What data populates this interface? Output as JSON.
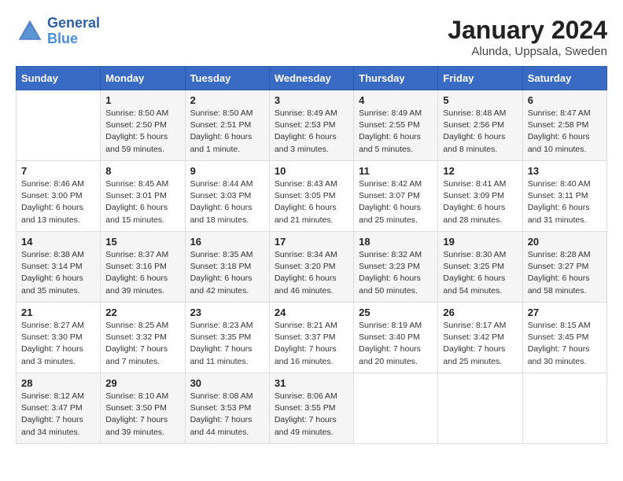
{
  "header": {
    "logo_general": "General",
    "logo_blue": "Blue",
    "month_year": "January 2024",
    "location": "Alunda, Uppsala, Sweden"
  },
  "days_of_week": [
    "Sunday",
    "Monday",
    "Tuesday",
    "Wednesday",
    "Thursday",
    "Friday",
    "Saturday"
  ],
  "weeks": [
    [
      {
        "day": "",
        "info": ""
      },
      {
        "day": "1",
        "info": "Sunrise: 8:50 AM\nSunset: 2:50 PM\nDaylight: 5 hours\nand 59 minutes."
      },
      {
        "day": "2",
        "info": "Sunrise: 8:50 AM\nSunset: 2:51 PM\nDaylight: 6 hours\nand 1 minute."
      },
      {
        "day": "3",
        "info": "Sunrise: 8:49 AM\nSunset: 2:53 PM\nDaylight: 6 hours\nand 3 minutes."
      },
      {
        "day": "4",
        "info": "Sunrise: 8:49 AM\nSunset: 2:55 PM\nDaylight: 6 hours\nand 5 minutes."
      },
      {
        "day": "5",
        "info": "Sunrise: 8:48 AM\nSunset: 2:56 PM\nDaylight: 6 hours\nand 8 minutes."
      },
      {
        "day": "6",
        "info": "Sunrise: 8:47 AM\nSunset: 2:58 PM\nDaylight: 6 hours\nand 10 minutes."
      }
    ],
    [
      {
        "day": "7",
        "info": "Sunrise: 8:46 AM\nSunset: 3:00 PM\nDaylight: 6 hours\nand 13 minutes."
      },
      {
        "day": "8",
        "info": "Sunrise: 8:45 AM\nSunset: 3:01 PM\nDaylight: 6 hours\nand 15 minutes."
      },
      {
        "day": "9",
        "info": "Sunrise: 8:44 AM\nSunset: 3:03 PM\nDaylight: 6 hours\nand 18 minutes."
      },
      {
        "day": "10",
        "info": "Sunrise: 8:43 AM\nSunset: 3:05 PM\nDaylight: 6 hours\nand 21 minutes."
      },
      {
        "day": "11",
        "info": "Sunrise: 8:42 AM\nSunset: 3:07 PM\nDaylight: 6 hours\nand 25 minutes."
      },
      {
        "day": "12",
        "info": "Sunrise: 8:41 AM\nSunset: 3:09 PM\nDaylight: 6 hours\nand 28 minutes."
      },
      {
        "day": "13",
        "info": "Sunrise: 8:40 AM\nSunset: 3:11 PM\nDaylight: 6 hours\nand 31 minutes."
      }
    ],
    [
      {
        "day": "14",
        "info": "Sunrise: 8:38 AM\nSunset: 3:14 PM\nDaylight: 6 hours\nand 35 minutes."
      },
      {
        "day": "15",
        "info": "Sunrise: 8:37 AM\nSunset: 3:16 PM\nDaylight: 6 hours\nand 39 minutes."
      },
      {
        "day": "16",
        "info": "Sunrise: 8:35 AM\nSunset: 3:18 PM\nDaylight: 6 hours\nand 42 minutes."
      },
      {
        "day": "17",
        "info": "Sunrise: 8:34 AM\nSunset: 3:20 PM\nDaylight: 6 hours\nand 46 minutes."
      },
      {
        "day": "18",
        "info": "Sunrise: 8:32 AM\nSunset: 3:23 PM\nDaylight: 6 hours\nand 50 minutes."
      },
      {
        "day": "19",
        "info": "Sunrise: 8:30 AM\nSunset: 3:25 PM\nDaylight: 6 hours\nand 54 minutes."
      },
      {
        "day": "20",
        "info": "Sunrise: 8:28 AM\nSunset: 3:27 PM\nDaylight: 6 hours\nand 58 minutes."
      }
    ],
    [
      {
        "day": "21",
        "info": "Sunrise: 8:27 AM\nSunset: 3:30 PM\nDaylight: 7 hours\nand 3 minutes."
      },
      {
        "day": "22",
        "info": "Sunrise: 8:25 AM\nSunset: 3:32 PM\nDaylight: 7 hours\nand 7 minutes."
      },
      {
        "day": "23",
        "info": "Sunrise: 8:23 AM\nSunset: 3:35 PM\nDaylight: 7 hours\nand 11 minutes."
      },
      {
        "day": "24",
        "info": "Sunrise: 8:21 AM\nSunset: 3:37 PM\nDaylight: 7 hours\nand 16 minutes."
      },
      {
        "day": "25",
        "info": "Sunrise: 8:19 AM\nSunset: 3:40 PM\nDaylight: 7 hours\nand 20 minutes."
      },
      {
        "day": "26",
        "info": "Sunrise: 8:17 AM\nSunset: 3:42 PM\nDaylight: 7 hours\nand 25 minutes."
      },
      {
        "day": "27",
        "info": "Sunrise: 8:15 AM\nSunset: 3:45 PM\nDaylight: 7 hours\nand 30 minutes."
      }
    ],
    [
      {
        "day": "28",
        "info": "Sunrise: 8:12 AM\nSunset: 3:47 PM\nDaylight: 7 hours\nand 34 minutes."
      },
      {
        "day": "29",
        "info": "Sunrise: 8:10 AM\nSunset: 3:50 PM\nDaylight: 7 hours\nand 39 minutes."
      },
      {
        "day": "30",
        "info": "Sunrise: 8:08 AM\nSunset: 3:53 PM\nDaylight: 7 hours\nand 44 minutes."
      },
      {
        "day": "31",
        "info": "Sunrise: 8:06 AM\nSunset: 3:55 PM\nDaylight: 7 hours\nand 49 minutes."
      },
      {
        "day": "",
        "info": ""
      },
      {
        "day": "",
        "info": ""
      },
      {
        "day": "",
        "info": ""
      }
    ]
  ]
}
